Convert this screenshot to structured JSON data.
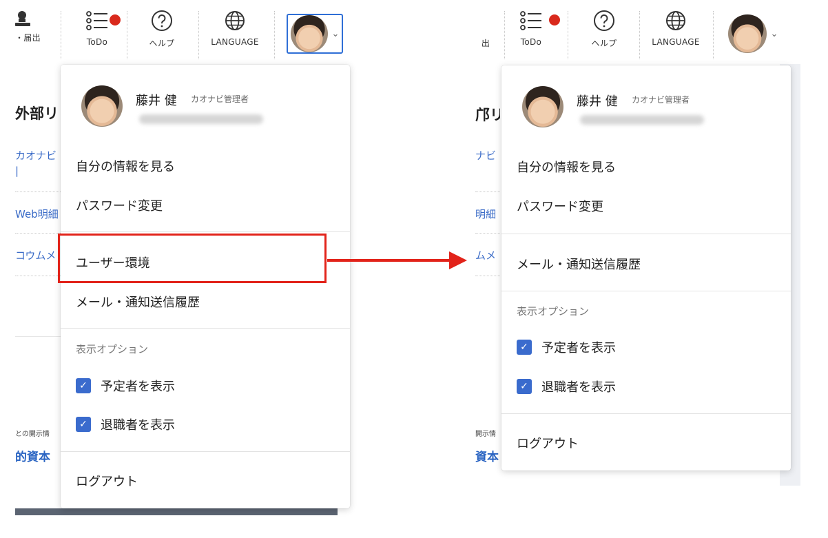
{
  "colors": {
    "accent": "#2f6fd6",
    "notification_dot": "#d9291c",
    "highlight": "#e2231a",
    "checkbox": "#3a6bcd"
  },
  "before": {
    "nav": {
      "partial_label": "・届出",
      "todo_label": "ToDo",
      "help_label": "ヘルプ",
      "language_label": "LANGUAGE"
    },
    "background": {
      "heading": "外部リ",
      "link1": "カオナビ",
      "link2": "Web明細",
      "link3": "コウムメ",
      "small_text": "との開示情",
      "blue_text": "的資本"
    },
    "menu": {
      "user_name": "藤井 健",
      "user_role": "カオナビ管理者",
      "view_profile": "自分の情報を見る",
      "change_password": "パスワード変更",
      "user_environment": "ユーザー環境",
      "mail_history": "メール・通知送信履歴",
      "display_options": "表示オプション",
      "show_scheduled": "予定者を表示",
      "show_retired": "退職者を表示",
      "logout": "ログアウト"
    }
  },
  "after": {
    "nav": {
      "partial_label": "出",
      "todo_label": "ToDo",
      "help_label": "ヘルプ",
      "language_label": "LANGUAGE"
    },
    "background": {
      "heading": "邝リ",
      "link1": "ナビ",
      "link2": "明細",
      "link3": "ムメ",
      "small_text": "開示情",
      "blue_text": "資本"
    },
    "menu": {
      "user_name": "藤井 健",
      "user_role": "カオナビ管理者",
      "view_profile": "自分の情報を見る",
      "change_password": "パスワード変更",
      "mail_history": "メール・通知送信履歴",
      "display_options": "表示オプション",
      "show_scheduled": "予定者を表示",
      "show_retired": "退職者を表示",
      "logout": "ログアウト"
    }
  }
}
